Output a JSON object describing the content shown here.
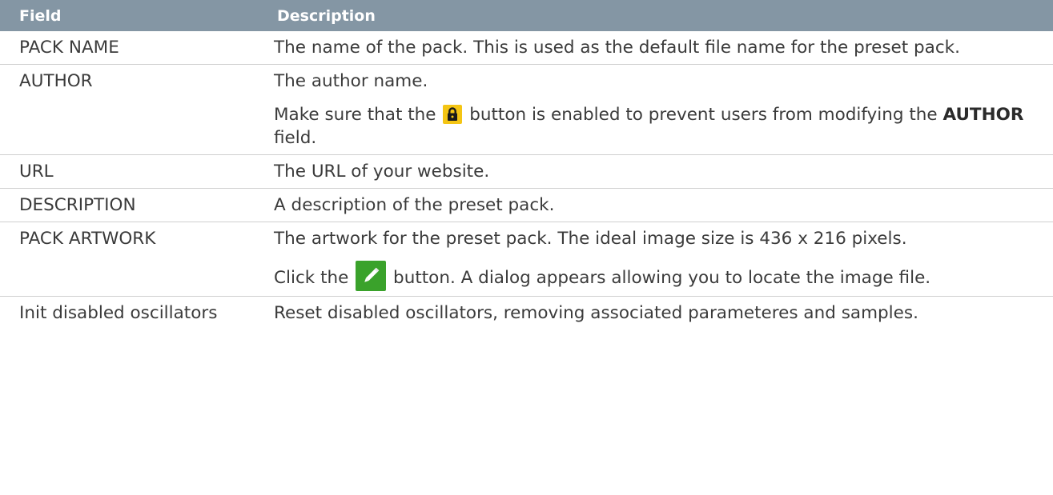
{
  "header": {
    "field": "Field",
    "description": "Description"
  },
  "rows": [
    {
      "field": "PACK NAME",
      "lines": [
        {
          "text": "The name of the pack. This is used as the default file name for the preset pack."
        }
      ]
    },
    {
      "field": "AUTHOR",
      "lines": [
        {
          "text": "The author name."
        },
        {
          "before": "Make sure that the",
          "icon": "lock-icon",
          "after_a": "button is enabled to prevent users from modifying the",
          "bold": "AUTHOR",
          "after_b": "field."
        }
      ]
    },
    {
      "field": "URL",
      "lines": [
        {
          "text": "The URL of your website."
        }
      ]
    },
    {
      "field": "DESCRIPTION",
      "lines": [
        {
          "text": "A description of the preset pack."
        }
      ]
    },
    {
      "field": "PACK ARTWORK",
      "lines": [
        {
          "text": "The artwork for the preset pack. The ideal image size is 436 x 216 pixels."
        },
        {
          "before": "Click the",
          "icon": "pencil-icon",
          "after": "button. A dialog appears allowing you to locate the image file."
        }
      ]
    },
    {
      "field": "Init disabled oscillators",
      "lines": [
        {
          "text": "Reset disabled oscillators, removing associated parameteres and samples."
        }
      ]
    }
  ],
  "colors": {
    "header_bg": "#8496a4",
    "lock_bg": "#f4c514",
    "pencil_bg": "#3aa22b"
  }
}
